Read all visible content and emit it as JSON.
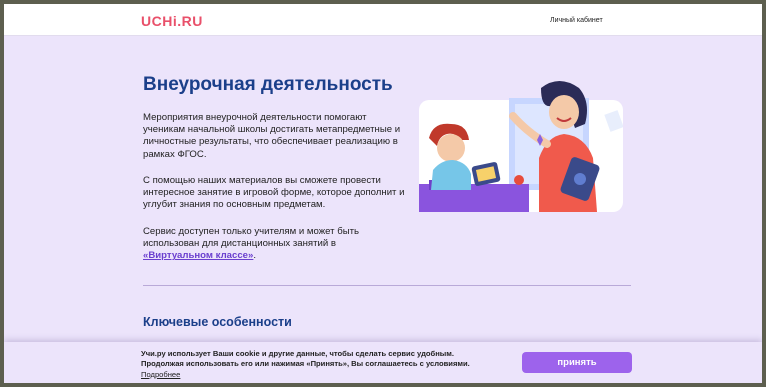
{
  "header": {
    "logo": "UCHi.RU",
    "cabinet_link": "Личный кабинет"
  },
  "main": {
    "title": "Внеурочная деятельность",
    "paragraph1": "Мероприятия внеурочной деятельности помогают ученикам начальной школы достигать метапредметные и личностные результаты, что обеспечивает реализацию в рамках ФГОС.",
    "paragraph2": "С помощью наших материалов вы сможете провести интересное занятие в игровой форме, которое дополнит и углубит знания по основным предметам.",
    "paragraph3_text": "Сервис доступен только учителям и может быть использован для дистанционных занятий в ",
    "paragraph3_link": "«Виртуальном классе»",
    "paragraph3_end": ".",
    "key_features_heading": "Ключевые особенности"
  },
  "cookie_banner": {
    "text": "Учи.ру использует Ваши cookie и другие данные, чтобы сделать сервис удобным. Продолжая использовать его или нажимая «Принять», Вы соглашаетесь с условиями.",
    "more_link": "Подробнее",
    "accept_button": "принять"
  },
  "colors": {
    "brand": "#e9506a",
    "accent": "#9d63ec",
    "heading": "#1b3f8a",
    "background": "#ece4fb"
  }
}
